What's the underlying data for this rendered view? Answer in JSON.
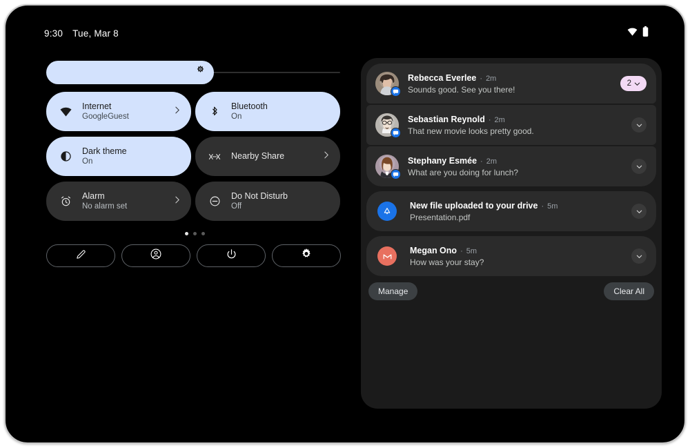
{
  "status_bar": {
    "time": "9:30",
    "date": "Tue, Mar 8",
    "wifi_icon": "wifi-icon",
    "battery_icon": "battery-icon"
  },
  "brightness": {
    "label": "Brightness",
    "value_percent": 57,
    "icon": "brightness-icon"
  },
  "tiles": [
    {
      "title": "Internet",
      "subtitle": "GoogleGuest",
      "icon": "wifi-icon",
      "active": true,
      "chevron": true
    },
    {
      "title": "Bluetooth",
      "subtitle": "On",
      "icon": "bluetooth-icon",
      "active": true,
      "chevron": false
    },
    {
      "title": "Dark theme",
      "subtitle": "On",
      "icon": "dark-theme-icon",
      "active": true,
      "chevron": false
    },
    {
      "title": "Nearby Share",
      "subtitle": "",
      "icon": "nearby-share-icon",
      "active": false,
      "chevron": true
    },
    {
      "title": "Alarm",
      "subtitle": "No alarm set",
      "icon": "alarm-icon",
      "active": false,
      "chevron": true
    },
    {
      "title": "Do Not Disturb",
      "subtitle": "Off",
      "icon": "do-not-disturb-icon",
      "active": false,
      "chevron": false
    }
  ],
  "pager": {
    "total": 3,
    "current": 1
  },
  "footer_buttons": [
    {
      "name": "edit-tiles-button",
      "icon": "pencil-icon"
    },
    {
      "name": "user-switch-button",
      "icon": "account-circle-icon"
    },
    {
      "name": "power-button",
      "icon": "power-icon"
    },
    {
      "name": "settings-button",
      "icon": "gear-icon"
    }
  ],
  "notifications": [
    {
      "name": "Rebecca Everlee",
      "separator": "·",
      "time": "2m",
      "message": "Sounds good. See you there!",
      "avatar_type": "photo-female-dark-hair",
      "app_badge": "messages-icon",
      "trailing": "count-badge",
      "count": "2",
      "group_pos": "grp-top"
    },
    {
      "name": "Sebastian Reynold",
      "separator": "·",
      "time": "2m",
      "message": "That new movie looks pretty good.",
      "avatar_type": "photo-male-glasses",
      "app_badge": "messages-icon",
      "trailing": "expand",
      "count": "",
      "group_pos": "grp-mid"
    },
    {
      "name": "Stephany Esmée",
      "separator": "·",
      "time": "2m",
      "message": "What are you doing for lunch?",
      "avatar_type": "photo-female-long-hair",
      "app_badge": "messages-icon",
      "trailing": "expand",
      "count": "",
      "group_pos": "grp-bot"
    },
    {
      "name": "New file uploaded to your drive",
      "separator": "·",
      "time": "5m",
      "message": "Presentation.pdf",
      "avatar_type": "app-drive",
      "app_badge": "",
      "trailing": "expand",
      "count": "",
      "group_pos": "solo"
    },
    {
      "name": "Megan Ono",
      "separator": "·",
      "time": "5m",
      "message": "How was your stay?",
      "avatar_type": "app-gmail",
      "app_badge": "",
      "trailing": "expand",
      "count": "",
      "group_pos": "solo"
    }
  ],
  "notif_actions": {
    "manage_label": "Manage",
    "clear_all_label": "Clear All"
  },
  "colors": {
    "tile_active_bg": "#d3e2fd",
    "tile_inactive_bg": "#303030",
    "panel_bg": "#1b1b1b",
    "card_bg": "#2b2b2b",
    "badge_pink": "#f3d9f5",
    "messages_blue": "#1a73e8",
    "gmail_red": "#e8705f",
    "drive_blue": "#1a73e8"
  }
}
